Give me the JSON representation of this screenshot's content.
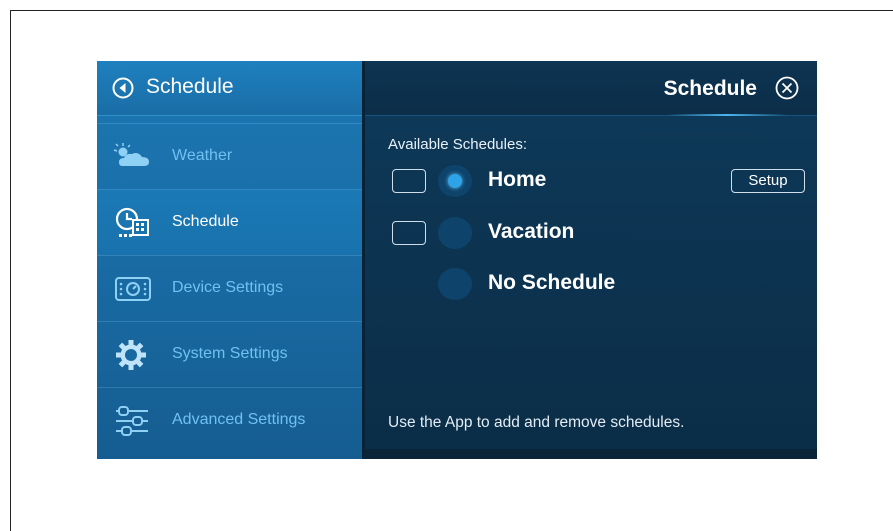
{
  "sidebar": {
    "title": "Schedule",
    "items": [
      {
        "label": "Weather",
        "icon": "cloud-icon",
        "active": false
      },
      {
        "label": "Schedule",
        "icon": "schedule-clock-icon",
        "active": true
      },
      {
        "label": "Device Settings",
        "icon": "device-icon",
        "active": false
      },
      {
        "label": "System Settings",
        "icon": "gear-icon",
        "active": false
      },
      {
        "label": "Advanced Settings",
        "icon": "sliders-icon",
        "active": false
      }
    ]
  },
  "main": {
    "title": "Schedule",
    "available_label": "Available Schedules:",
    "schedules": [
      {
        "name": "Home",
        "selected": true,
        "has_checkbox": true
      },
      {
        "name": "Vacation",
        "selected": false,
        "has_checkbox": true
      },
      {
        "name": "No Schedule",
        "selected": false,
        "has_checkbox": false
      }
    ],
    "setup_label": "Setup",
    "footer_note": "Use the App to add and remove schedules."
  },
  "colors": {
    "sidebar_bg": "#1a6ea8",
    "main_bg": "#0c2f4a",
    "accent": "#2fa3e8",
    "inactive_label": "#6fc1f0"
  }
}
